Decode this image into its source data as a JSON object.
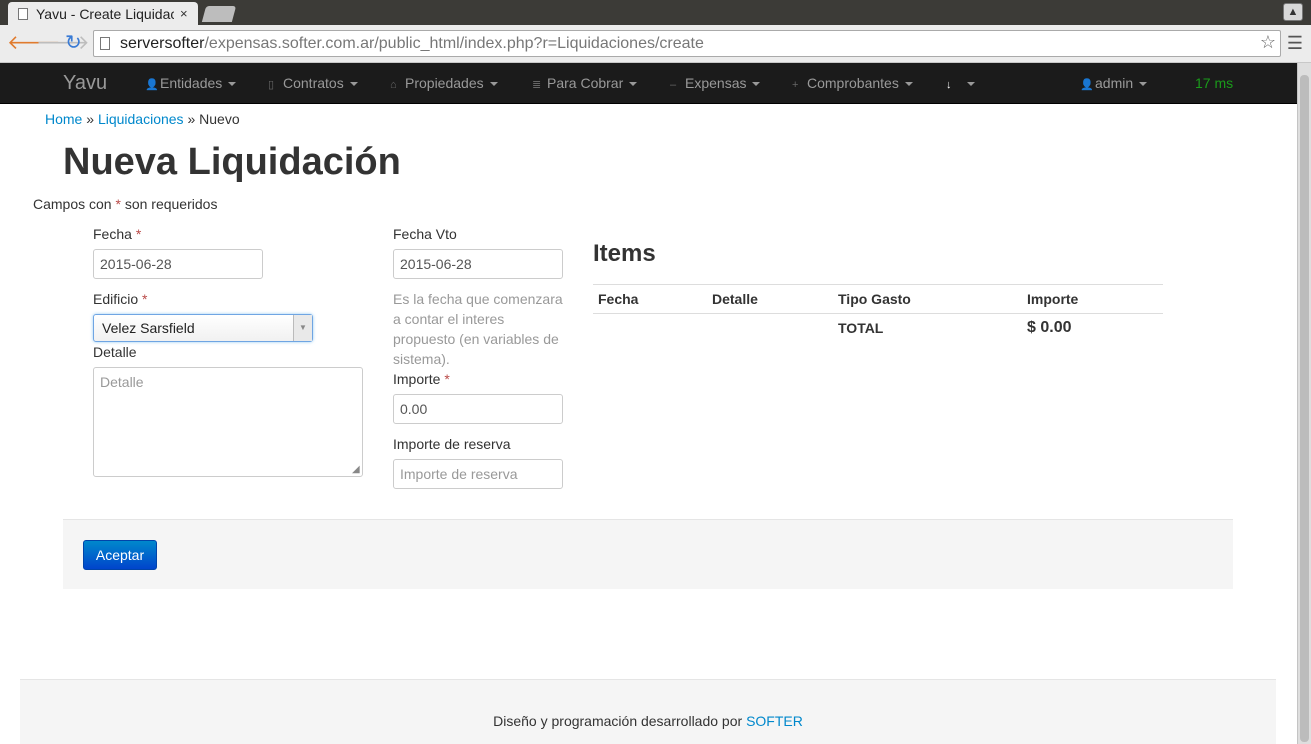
{
  "browser": {
    "tab_title": "Yavu - Create Liquidaciones",
    "tab_close": "×",
    "url_host": "serversofter",
    "url_path": "/expensas.softer.com.ar/public_html/index.php?r=Liquidaciones/create"
  },
  "navbar": {
    "brand": "Yavu",
    "items": [
      {
        "label": "Entidades",
        "icon": "user-icon"
      },
      {
        "label": "Contratos",
        "icon": "file-icon"
      },
      {
        "label": "Propiedades",
        "icon": "home-icon"
      },
      {
        "label": "Para Cobrar",
        "icon": "list-icon"
      },
      {
        "label": "Expensas",
        "icon": "minus-icon"
      },
      {
        "label": "Comprobantes",
        "icon": "plus-icon"
      },
      {
        "label": "",
        "icon": "download-icon"
      }
    ],
    "user": "admin",
    "timing": "17 ms"
  },
  "breadcrumb": {
    "home": "Home",
    "sep": "»",
    "section": "Liquidaciones",
    "current": "Nuevo"
  },
  "page": {
    "title": "Nueva Liquidación",
    "required_note_prefix": "Campos con",
    "required_star": "*",
    "required_note_suffix": "son requeridos"
  },
  "form": {
    "fecha_label": "Fecha",
    "fecha_value": "2015-06-28",
    "edificio_label": "Edificio",
    "edificio_value": "Velez Sarsfield",
    "detalle_label": "Detalle",
    "detalle_placeholder": "Detalle",
    "fecha_vto_label": "Fecha Vto",
    "fecha_vto_value": "2015-06-28",
    "fecha_vto_help": "Es la fecha que comenzara a contar el interes propuesto (en variables de sistema).",
    "importe_label": "Importe",
    "importe_value": "0.00",
    "importe_reserva_label": "Importe de reserva",
    "importe_reserva_placeholder": "Importe de reserva",
    "submit": "Aceptar"
  },
  "items": {
    "title": "Items",
    "columns": [
      "Fecha",
      "Detalle",
      "Tipo Gasto",
      "Importe"
    ],
    "total_label": "TOTAL",
    "total_value": "$ 0.00"
  },
  "footer": {
    "text": "Diseño y programación desarrollado por",
    "link": "SOFTER"
  }
}
